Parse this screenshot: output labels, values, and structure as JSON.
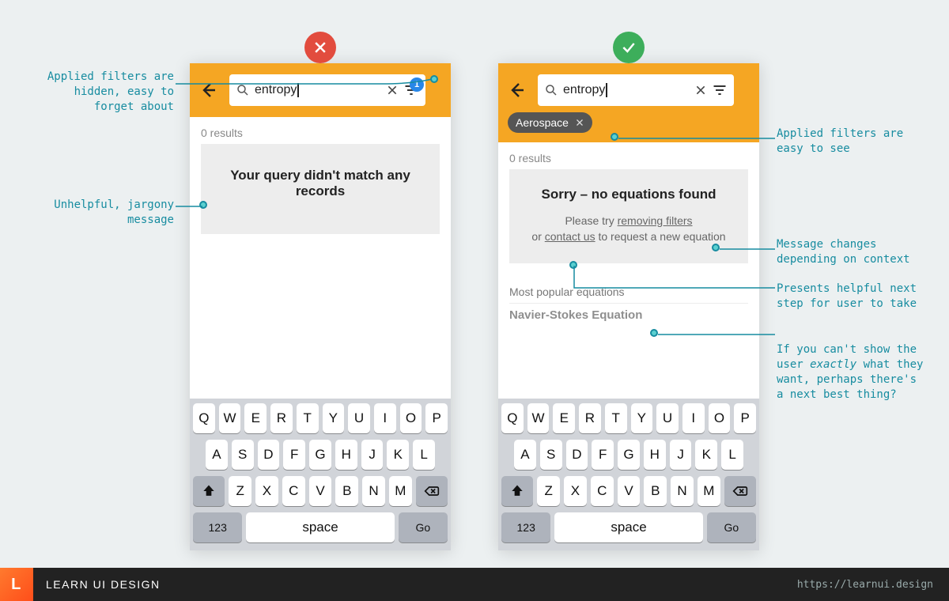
{
  "footer": {
    "brand": "LEARN UI DESIGN",
    "url": "https://learnui.design",
    "logo_letter": "L"
  },
  "keyboard": {
    "row1": [
      "Q",
      "W",
      "E",
      "R",
      "T",
      "Y",
      "U",
      "I",
      "O",
      "P"
    ],
    "row2": [
      "A",
      "S",
      "D",
      "F",
      "G",
      "H",
      "J",
      "K",
      "L"
    ],
    "row3": [
      "Z",
      "X",
      "C",
      "V",
      "B",
      "N",
      "M"
    ],
    "numkey": "123",
    "space": "space",
    "go": "Go"
  },
  "bad": {
    "search_value": "entropy",
    "filter_badge": "1",
    "results_count": "0 results",
    "empty_title": "Your query didn't match any records"
  },
  "good": {
    "search_value": "entropy",
    "chip_label": "Aerospace",
    "results_count": "0 results",
    "empty_title": "Sorry – no equations found",
    "sub_prefix": "Please try ",
    "link_remove": "removing filters",
    "sub_mid": "or ",
    "link_contact": "contact us",
    "sub_suffix": " to request a new equation",
    "section": "Most popular equations",
    "row1_title": "Navier-Stokes Equation"
  },
  "notes": {
    "hidden_filters": "Applied filters are\nhidden, easy to\nforget about",
    "jargony": "Unhelpful, jargony\nmessage",
    "visible_filters": "Applied filters are\neasy to see",
    "contextual": "Message changes\ndepending on context",
    "next_step": "Presents helpful next\nstep for user to take",
    "next_best_a": "If you can't show the\nuser ",
    "next_best_em": "exactly",
    "next_best_b": " what they\nwant, perhaps there's\na next best thing?"
  }
}
